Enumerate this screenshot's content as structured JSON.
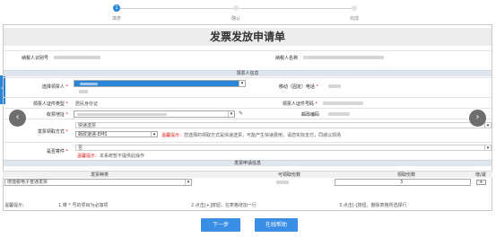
{
  "steps": [
    {
      "num": "1",
      "label": "填表"
    },
    {
      "num": "",
      "label": "确认"
    },
    {
      "num": "",
      "label": "完成"
    }
  ],
  "title": "发票发放申请单",
  "top_fields": {
    "taxpayer_id_label": "纳税人识别号",
    "taxpayer_name_label": "纳税人名称"
  },
  "recipient_section": "领票人信息",
  "fields": {
    "choose_recipient": "选择领票人",
    "mobile": "移动（固定）电话",
    "id_type": "领票人证件类型",
    "id_type_value": "居民身份证",
    "id_number": "领票人证件号码",
    "address": "收票地址",
    "postcode": "邮政编码",
    "method": "发票领取方式",
    "method_value1": "快递送票",
    "method_value2": "邮政速递-EMS",
    "method_tip_prefix": "温馨提示：",
    "method_tip": "您选择的领取方式是快递送票，可能产生快递费用，请您实际支付，同城以现场",
    "pay": "是否寄件",
    "pay_value": "否",
    "pay_tip_prefix": "温馨提示：",
    "pay_tip": "本系统暂不提供此操作"
  },
  "req_mark": "*",
  "invoice_section": "发票申请信息",
  "table": {
    "headers": [
      "发票种类",
      "可领取份数",
      "领取份数",
      "增/减"
    ],
    "row": {
      "type": "增值税电子普通发票",
      "count": "3",
      "add": "+"
    }
  },
  "tips": {
    "label": "温馨提示：",
    "t1": "1.带 * 号的项目为必填项",
    "t2": "2.点击[+]按钮，在表格增加一行",
    "t3": "3.点击[-]按钮，删除表格所选择行"
  },
  "buttons": {
    "next": "下一步",
    "help": "在线帮助"
  },
  "icons": {
    "prev": "‹",
    "next": "›",
    "side": "›",
    "dropdown": "▾",
    "edit": "✎"
  },
  "colors": {
    "accent": "#2a85d8",
    "required": "#d22222"
  }
}
